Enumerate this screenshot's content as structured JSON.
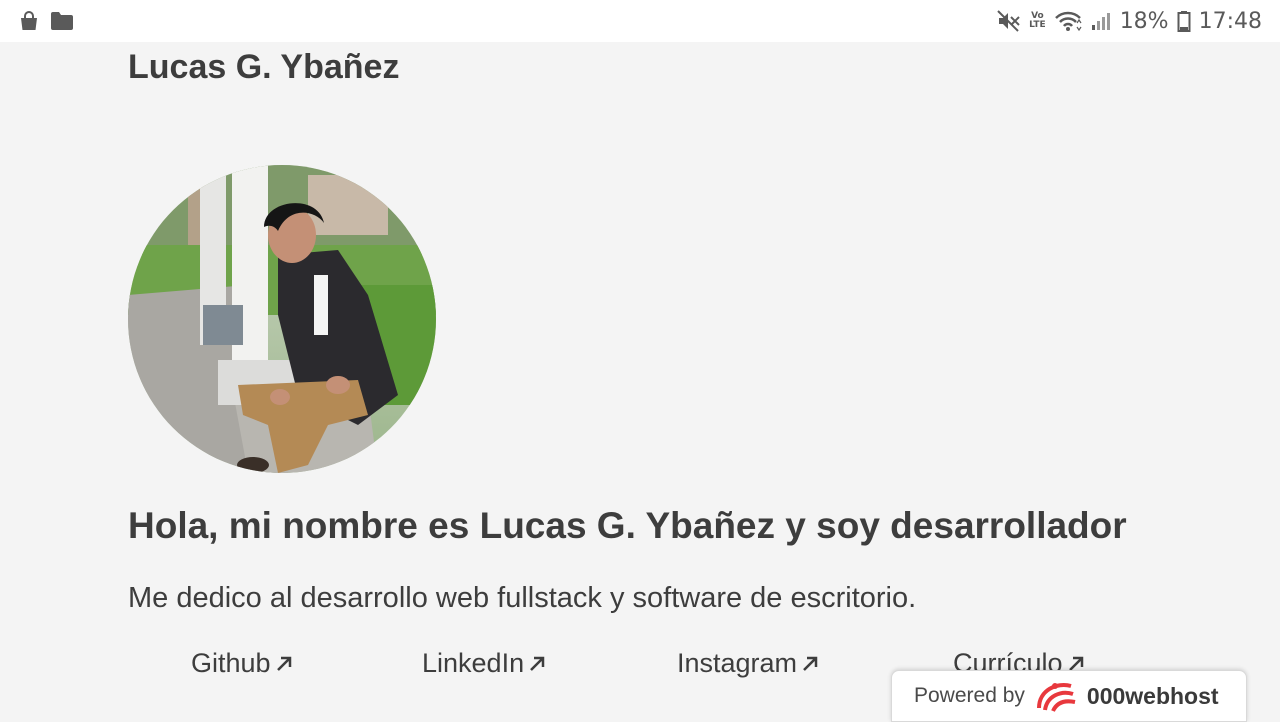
{
  "status_bar": {
    "battery_percent": "18%",
    "time": "17:48",
    "lte_label_top": "Vo",
    "lte_label_bottom": "LTE",
    "left_icons": [
      "shopping-bag-icon",
      "folder-icon"
    ],
    "right_icons": [
      "mute-icon",
      "volte-icon",
      "wifi-icon",
      "signal-icon",
      "battery-icon"
    ]
  },
  "header": {
    "title": "Lucas G. Ybañez"
  },
  "profile": {
    "photo": "profile-photo"
  },
  "intro": {
    "heading": "Hola, mi nombre es Lucas G. Ybañez y soy desarrollador",
    "tagline": "Me dedico al desarrollo web fullstack y software de escritorio."
  },
  "links": [
    {
      "label": "Github",
      "icon": "external-arrow-icon"
    },
    {
      "label": "LinkedIn",
      "icon": "external-arrow-icon"
    },
    {
      "label": "Instagram",
      "icon": "external-arrow-icon"
    },
    {
      "label": "Currículo",
      "icon": "external-arrow-icon"
    }
  ],
  "powered_by": {
    "label": "Powered by",
    "brand": "000webhost",
    "logo_color": "#e8383d"
  }
}
